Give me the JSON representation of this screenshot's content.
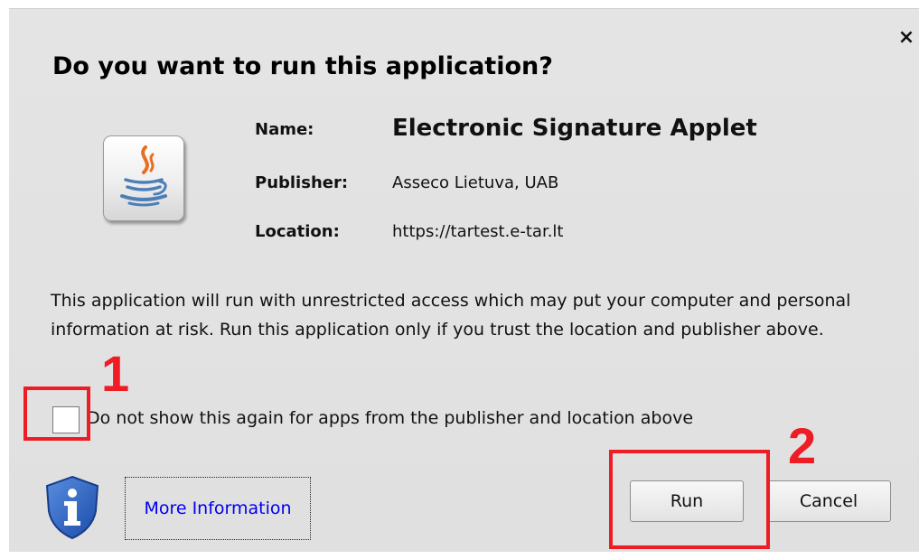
{
  "dialog": {
    "close_glyph": "×",
    "title": "Do you want to run this application?",
    "app_icon": "java-icon",
    "fields": {
      "name_label": "Name:",
      "name_value": "Electronic Signature Applet",
      "publisher_label": "Publisher:",
      "publisher_value": "Asseco Lietuva, UAB",
      "location_label": "Location:",
      "location_value": "https://tartest.e-tar.lt"
    },
    "warning_text": "This application will run with unrestricted access which may put your computer and personal information at risk. Run this application only if you trust the location and publisher above.",
    "checkbox": {
      "label": "Do not show this again for apps from the publisher and location above",
      "checked": false
    },
    "info_icon": "shield-info-icon",
    "more_info_link": "More Information",
    "run_button": "Run",
    "cancel_button": "Cancel"
  },
  "annotations": {
    "marker_1": "1",
    "marker_2": "2",
    "color": "#ee1c25"
  }
}
